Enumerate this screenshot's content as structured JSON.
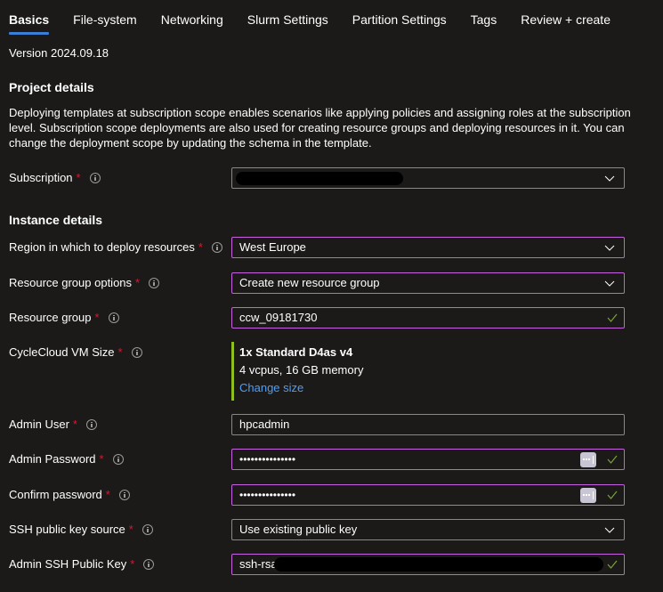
{
  "tabs": [
    {
      "label": "Basics",
      "active": true
    },
    {
      "label": "File-system",
      "active": false
    },
    {
      "label": "Networking",
      "active": false
    },
    {
      "label": "Slurm Settings",
      "active": false
    },
    {
      "label": "Partition Settings",
      "active": false
    },
    {
      "label": "Tags",
      "active": false
    },
    {
      "label": "Review + create",
      "active": false
    }
  ],
  "version": "Version 2024.09.18",
  "project_details": {
    "title": "Project details",
    "description": "Deploying templates at subscription scope enables scenarios like applying policies and assigning roles at the subscription level. Subscription scope deployments are also used for creating resource groups and deploying resources in it. You can change the deployment scope by updating the schema in the template.",
    "subscription": {
      "label": "Subscription",
      "required_marker": "*",
      "value": "[redacted]"
    }
  },
  "instance_details": {
    "title": "Instance details",
    "region": {
      "label": "Region in which to deploy resources",
      "required_marker": "*",
      "value": "West Europe"
    },
    "resource_group_options": {
      "label": "Resource group options",
      "required_marker": "*",
      "value": "Create new resource group"
    },
    "resource_group": {
      "label": "Resource group",
      "required_marker": "*",
      "value": "ccw_09181730"
    },
    "vm_size": {
      "label": "CycleCloud VM Size",
      "required_marker": "*",
      "name": "1x Standard D4as v4",
      "spec": "4 vcpus, 16 GB memory",
      "change_link": "Change size"
    },
    "admin_user": {
      "label": "Admin User",
      "required_marker": "*",
      "value": "hpcadmin"
    },
    "admin_password": {
      "label": "Admin Password",
      "required_marker": "*",
      "value": "•••••••••••••••"
    },
    "confirm_password": {
      "label": "Confirm password",
      "required_marker": "*",
      "value": "•••••••••••••••"
    },
    "ssh_key_source": {
      "label": "SSH public key source",
      "required_marker": "*",
      "value": "Use existing public key"
    },
    "ssh_public_key": {
      "label": "Admin SSH Public Key",
      "required_marker": "*",
      "value": "ssh-rsa"
    }
  },
  "colors": {
    "background": "#1b1a19",
    "tab_indicator": "#3a7fd5",
    "required": "#e0152f",
    "valid_border": "#c560e0",
    "check": "#7aa33a",
    "vm_accent": "#8fbf1f",
    "link": "#4f9ef5"
  }
}
